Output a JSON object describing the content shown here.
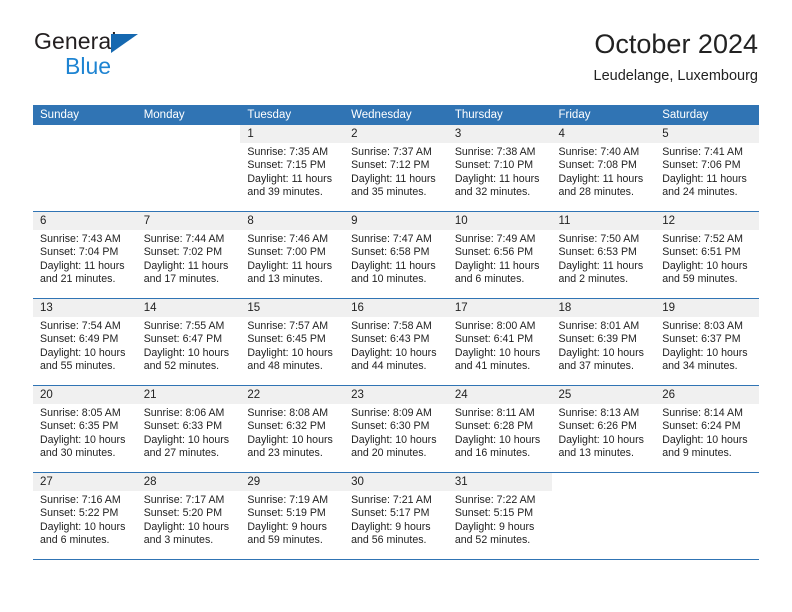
{
  "brand": {
    "word_one": "General",
    "word_two": "Blue",
    "triangle_icon": "brand-triangle-icon",
    "accent_color": "#1e84d2"
  },
  "header": {
    "title": "October 2024",
    "location": "Leudelange, Luxembourg"
  },
  "theme": {
    "header_blue": "#3074b4",
    "daynum_gray": "#f0f0f0",
    "text": "#222222"
  },
  "weekday_headers": [
    "Sunday",
    "Monday",
    "Tuesday",
    "Wednesday",
    "Thursday",
    "Friday",
    "Saturday"
  ],
  "labels": {
    "sunrise_prefix": "Sunrise: ",
    "sunset_prefix": "Sunset: ",
    "daylight_prefix": "Daylight: "
  },
  "weeks": [
    [
      {
        "day": "",
        "sunrise": "",
        "sunset": "",
        "daylight_line1": "",
        "daylight_line2": "",
        "blank": true
      },
      {
        "day": "",
        "sunrise": "",
        "sunset": "",
        "daylight_line1": "",
        "daylight_line2": "",
        "blank": true
      },
      {
        "day": "1",
        "sunrise": "Sunrise: 7:35 AM",
        "sunset": "Sunset: 7:15 PM",
        "daylight_line1": "Daylight: 11 hours",
        "daylight_line2": "and 39 minutes."
      },
      {
        "day": "2",
        "sunrise": "Sunrise: 7:37 AM",
        "sunset": "Sunset: 7:12 PM",
        "daylight_line1": "Daylight: 11 hours",
        "daylight_line2": "and 35 minutes."
      },
      {
        "day": "3",
        "sunrise": "Sunrise: 7:38 AM",
        "sunset": "Sunset: 7:10 PM",
        "daylight_line1": "Daylight: 11 hours",
        "daylight_line2": "and 32 minutes."
      },
      {
        "day": "4",
        "sunrise": "Sunrise: 7:40 AM",
        "sunset": "Sunset: 7:08 PM",
        "daylight_line1": "Daylight: 11 hours",
        "daylight_line2": "and 28 minutes."
      },
      {
        "day": "5",
        "sunrise": "Sunrise: 7:41 AM",
        "sunset": "Sunset: 7:06 PM",
        "daylight_line1": "Daylight: 11 hours",
        "daylight_line2": "and 24 minutes."
      }
    ],
    [
      {
        "day": "6",
        "sunrise": "Sunrise: 7:43 AM",
        "sunset": "Sunset: 7:04 PM",
        "daylight_line1": "Daylight: 11 hours",
        "daylight_line2": "and 21 minutes."
      },
      {
        "day": "7",
        "sunrise": "Sunrise: 7:44 AM",
        "sunset": "Sunset: 7:02 PM",
        "daylight_line1": "Daylight: 11 hours",
        "daylight_line2": "and 17 minutes."
      },
      {
        "day": "8",
        "sunrise": "Sunrise: 7:46 AM",
        "sunset": "Sunset: 7:00 PM",
        "daylight_line1": "Daylight: 11 hours",
        "daylight_line2": "and 13 minutes."
      },
      {
        "day": "9",
        "sunrise": "Sunrise: 7:47 AM",
        "sunset": "Sunset: 6:58 PM",
        "daylight_line1": "Daylight: 11 hours",
        "daylight_line2": "and 10 minutes."
      },
      {
        "day": "10",
        "sunrise": "Sunrise: 7:49 AM",
        "sunset": "Sunset: 6:56 PM",
        "daylight_line1": "Daylight: 11 hours",
        "daylight_line2": "and 6 minutes."
      },
      {
        "day": "11",
        "sunrise": "Sunrise: 7:50 AM",
        "sunset": "Sunset: 6:53 PM",
        "daylight_line1": "Daylight: 11 hours",
        "daylight_line2": "and 2 minutes."
      },
      {
        "day": "12",
        "sunrise": "Sunrise: 7:52 AM",
        "sunset": "Sunset: 6:51 PM",
        "daylight_line1": "Daylight: 10 hours",
        "daylight_line2": "and 59 minutes."
      }
    ],
    [
      {
        "day": "13",
        "sunrise": "Sunrise: 7:54 AM",
        "sunset": "Sunset: 6:49 PM",
        "daylight_line1": "Daylight: 10 hours",
        "daylight_line2": "and 55 minutes."
      },
      {
        "day": "14",
        "sunrise": "Sunrise: 7:55 AM",
        "sunset": "Sunset: 6:47 PM",
        "daylight_line1": "Daylight: 10 hours",
        "daylight_line2": "and 52 minutes."
      },
      {
        "day": "15",
        "sunrise": "Sunrise: 7:57 AM",
        "sunset": "Sunset: 6:45 PM",
        "daylight_line1": "Daylight: 10 hours",
        "daylight_line2": "and 48 minutes."
      },
      {
        "day": "16",
        "sunrise": "Sunrise: 7:58 AM",
        "sunset": "Sunset: 6:43 PM",
        "daylight_line1": "Daylight: 10 hours",
        "daylight_line2": "and 44 minutes."
      },
      {
        "day": "17",
        "sunrise": "Sunrise: 8:00 AM",
        "sunset": "Sunset: 6:41 PM",
        "daylight_line1": "Daylight: 10 hours",
        "daylight_line2": "and 41 minutes."
      },
      {
        "day": "18",
        "sunrise": "Sunrise: 8:01 AM",
        "sunset": "Sunset: 6:39 PM",
        "daylight_line1": "Daylight: 10 hours",
        "daylight_line2": "and 37 minutes."
      },
      {
        "day": "19",
        "sunrise": "Sunrise: 8:03 AM",
        "sunset": "Sunset: 6:37 PM",
        "daylight_line1": "Daylight: 10 hours",
        "daylight_line2": "and 34 minutes."
      }
    ],
    [
      {
        "day": "20",
        "sunrise": "Sunrise: 8:05 AM",
        "sunset": "Sunset: 6:35 PM",
        "daylight_line1": "Daylight: 10 hours",
        "daylight_line2": "and 30 minutes."
      },
      {
        "day": "21",
        "sunrise": "Sunrise: 8:06 AM",
        "sunset": "Sunset: 6:33 PM",
        "daylight_line1": "Daylight: 10 hours",
        "daylight_line2": "and 27 minutes."
      },
      {
        "day": "22",
        "sunrise": "Sunrise: 8:08 AM",
        "sunset": "Sunset: 6:32 PM",
        "daylight_line1": "Daylight: 10 hours",
        "daylight_line2": "and 23 minutes."
      },
      {
        "day": "23",
        "sunrise": "Sunrise: 8:09 AM",
        "sunset": "Sunset: 6:30 PM",
        "daylight_line1": "Daylight: 10 hours",
        "daylight_line2": "and 20 minutes."
      },
      {
        "day": "24",
        "sunrise": "Sunrise: 8:11 AM",
        "sunset": "Sunset: 6:28 PM",
        "daylight_line1": "Daylight: 10 hours",
        "daylight_line2": "and 16 minutes."
      },
      {
        "day": "25",
        "sunrise": "Sunrise: 8:13 AM",
        "sunset": "Sunset: 6:26 PM",
        "daylight_line1": "Daylight: 10 hours",
        "daylight_line2": "and 13 minutes."
      },
      {
        "day": "26",
        "sunrise": "Sunrise: 8:14 AM",
        "sunset": "Sunset: 6:24 PM",
        "daylight_line1": "Daylight: 10 hours",
        "daylight_line2": "and 9 minutes."
      }
    ],
    [
      {
        "day": "27",
        "sunrise": "Sunrise: 7:16 AM",
        "sunset": "Sunset: 5:22 PM",
        "daylight_line1": "Daylight: 10 hours",
        "daylight_line2": "and 6 minutes."
      },
      {
        "day": "28",
        "sunrise": "Sunrise: 7:17 AM",
        "sunset": "Sunset: 5:20 PM",
        "daylight_line1": "Daylight: 10 hours",
        "daylight_line2": "and 3 minutes."
      },
      {
        "day": "29",
        "sunrise": "Sunrise: 7:19 AM",
        "sunset": "Sunset: 5:19 PM",
        "daylight_line1": "Daylight: 9 hours",
        "daylight_line2": "and 59 minutes."
      },
      {
        "day": "30",
        "sunrise": "Sunrise: 7:21 AM",
        "sunset": "Sunset: 5:17 PM",
        "daylight_line1": "Daylight: 9 hours",
        "daylight_line2": "and 56 minutes."
      },
      {
        "day": "31",
        "sunrise": "Sunrise: 7:22 AM",
        "sunset": "Sunset: 5:15 PM",
        "daylight_line1": "Daylight: 9 hours",
        "daylight_line2": "and 52 minutes."
      },
      {
        "day": "",
        "sunrise": "",
        "sunset": "",
        "daylight_line1": "",
        "daylight_line2": "",
        "blank": true
      },
      {
        "day": "",
        "sunrise": "",
        "sunset": "",
        "daylight_line1": "",
        "daylight_line2": "",
        "blank": true
      }
    ]
  ]
}
